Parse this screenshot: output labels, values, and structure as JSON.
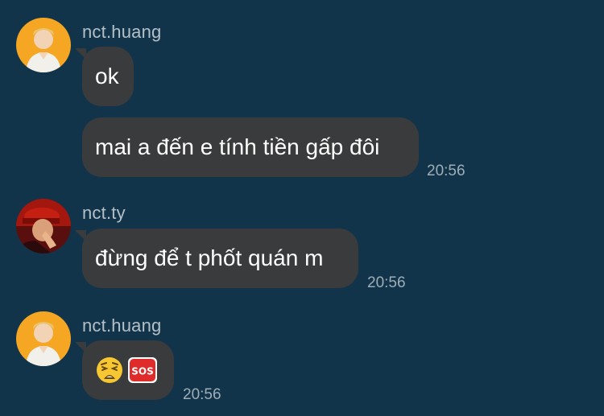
{
  "chat": {
    "messages": [
      {
        "sender": "nct.huang",
        "avatar_icon": "person-avatar-orange",
        "bubbles": [
          {
            "text": "ok"
          },
          {
            "text": "mai a đến e tính tiền gấp đôi",
            "time": "20:56"
          }
        ]
      },
      {
        "sender": "nct.ty",
        "avatar_icon": "person-avatar-red",
        "bubbles": [
          {
            "text": "đừng để t phốt quán m",
            "time": "20:56"
          }
        ]
      },
      {
        "sender": "nct.huang",
        "avatar_icon": "person-avatar-orange",
        "bubbles": [
          {
            "emojis": [
              "weary-face-emoji",
              "sos-emoji"
            ],
            "sos_text": "SOS",
            "time": "20:56"
          }
        ]
      }
    ]
  },
  "colors": {
    "background": "#12344a",
    "bubble": "#3a3b3d",
    "name_text": "#b4c0c8",
    "time_text": "#9fadb6"
  }
}
